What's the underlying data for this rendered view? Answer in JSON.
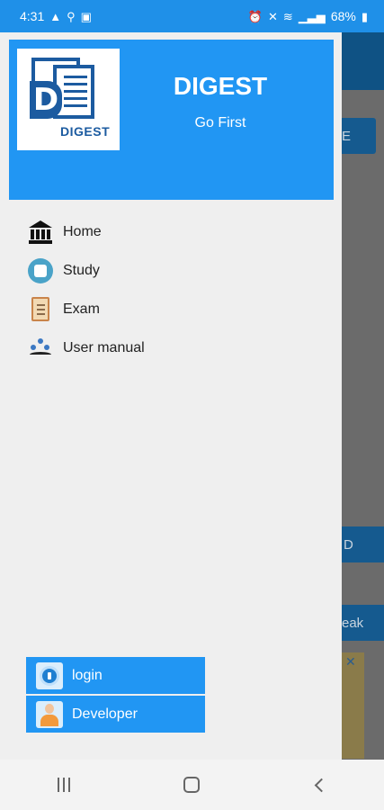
{
  "status_bar": {
    "time": "4:31",
    "battery": "68%",
    "left_icons": [
      "alert-icon",
      "usb-icon",
      "image-icon"
    ],
    "right_icons": [
      "alarm-icon",
      "mute-icon",
      "wifi-icon",
      "signal-icon",
      "battery-icon"
    ]
  },
  "drawer": {
    "header": {
      "logo_word": "DIGEST",
      "logo_letter": "D",
      "title": "DIGEST",
      "subtitle": "Go First",
      "background": "#2196f3"
    },
    "menu": [
      {
        "label": "Home",
        "icon": "bank-icon"
      },
      {
        "label": "Study",
        "icon": "study-icon"
      },
      {
        "label": "Exam",
        "icon": "exam-clipboard-icon"
      },
      {
        "label": "User manual",
        "icon": "user-manual-icon"
      }
    ],
    "bottom_buttons": [
      {
        "label": "login",
        "icon": "login-icon"
      },
      {
        "label": "Developer",
        "icon": "developer-icon"
      }
    ]
  },
  "background_app": {
    "button_fragment_1": "E",
    "button_fragment_2": "D",
    "button_fragment_3": "eak",
    "ad_close": "✕"
  },
  "nav_bar": {
    "buttons": [
      "recent-apps-button",
      "home-button",
      "back-button"
    ]
  },
  "colors": {
    "accent": "#2196f3",
    "status_bar": "#1f90e8"
  }
}
